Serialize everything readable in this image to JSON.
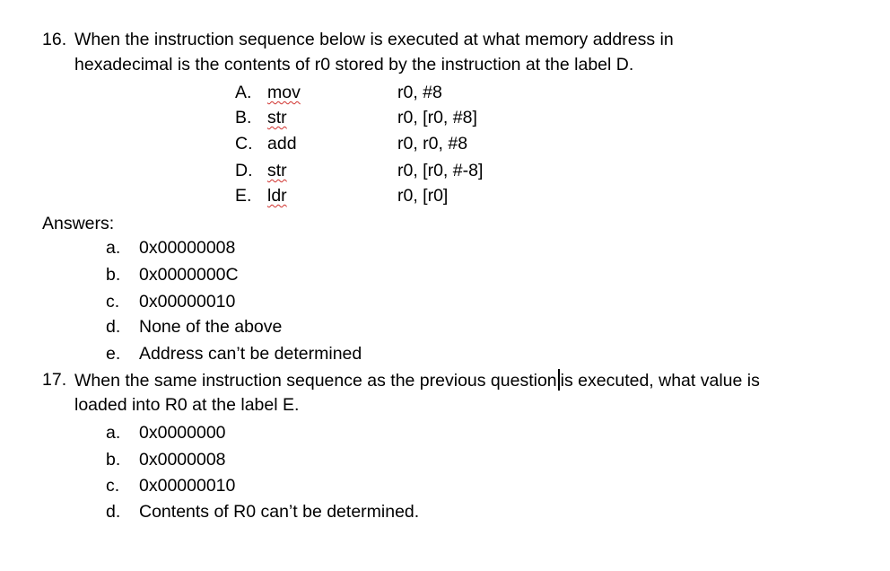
{
  "q16": {
    "number": "16.",
    "line1": "When the instruction sequence below is executed at what memory address in",
    "line2": "hexadecimal is the contents of r0 stored by the instruction at the label D.",
    "instructions": [
      {
        "label": "A.",
        "op": "mov",
        "operands": "r0, #8",
        "spellcheck_flag": true
      },
      {
        "label": "B.",
        "op": "str",
        "operands": "r0, [r0, #8]",
        "spellcheck_flag": true
      },
      {
        "label": "C.",
        "op": "add",
        "operands": "r0, r0, #8",
        "spellcheck_flag": false
      },
      {
        "label": "D.",
        "op": "str",
        "operands": "r0, [r0, #-8]",
        "spellcheck_flag": true
      },
      {
        "label": "E.",
        "op": "ldr",
        "operands": "r0, [r0]",
        "spellcheck_flag": true
      }
    ],
    "answers_heading": "Answers:",
    "answers": [
      {
        "letter": "a.",
        "text": "0x00000008"
      },
      {
        "letter": "b.",
        "text": "0x0000000C"
      },
      {
        "letter": "c.",
        "text": "0x00000010"
      },
      {
        "letter": "d.",
        "text": "None of the above"
      },
      {
        "letter": "e.",
        "text": "Address can’t be determined"
      }
    ]
  },
  "q17": {
    "number": "17.",
    "line1_before_caret": "When the same instruction sequence as the previous question",
    "line1_after_caret": "is executed, what value is",
    "line2": "loaded into R0 at the label E.",
    "answers": [
      {
        "letter": "a.",
        "text": "0x0000000"
      },
      {
        "letter": "b.",
        "text": "0x0000008"
      },
      {
        "letter": "c.",
        "text": "0x00000010"
      },
      {
        "letter": "d.",
        "text": "Contents of R0 can’t be determined."
      }
    ]
  },
  "colors": {
    "text": "#000000",
    "spellcheck_underline": "#d0312d",
    "background": "#ffffff"
  }
}
